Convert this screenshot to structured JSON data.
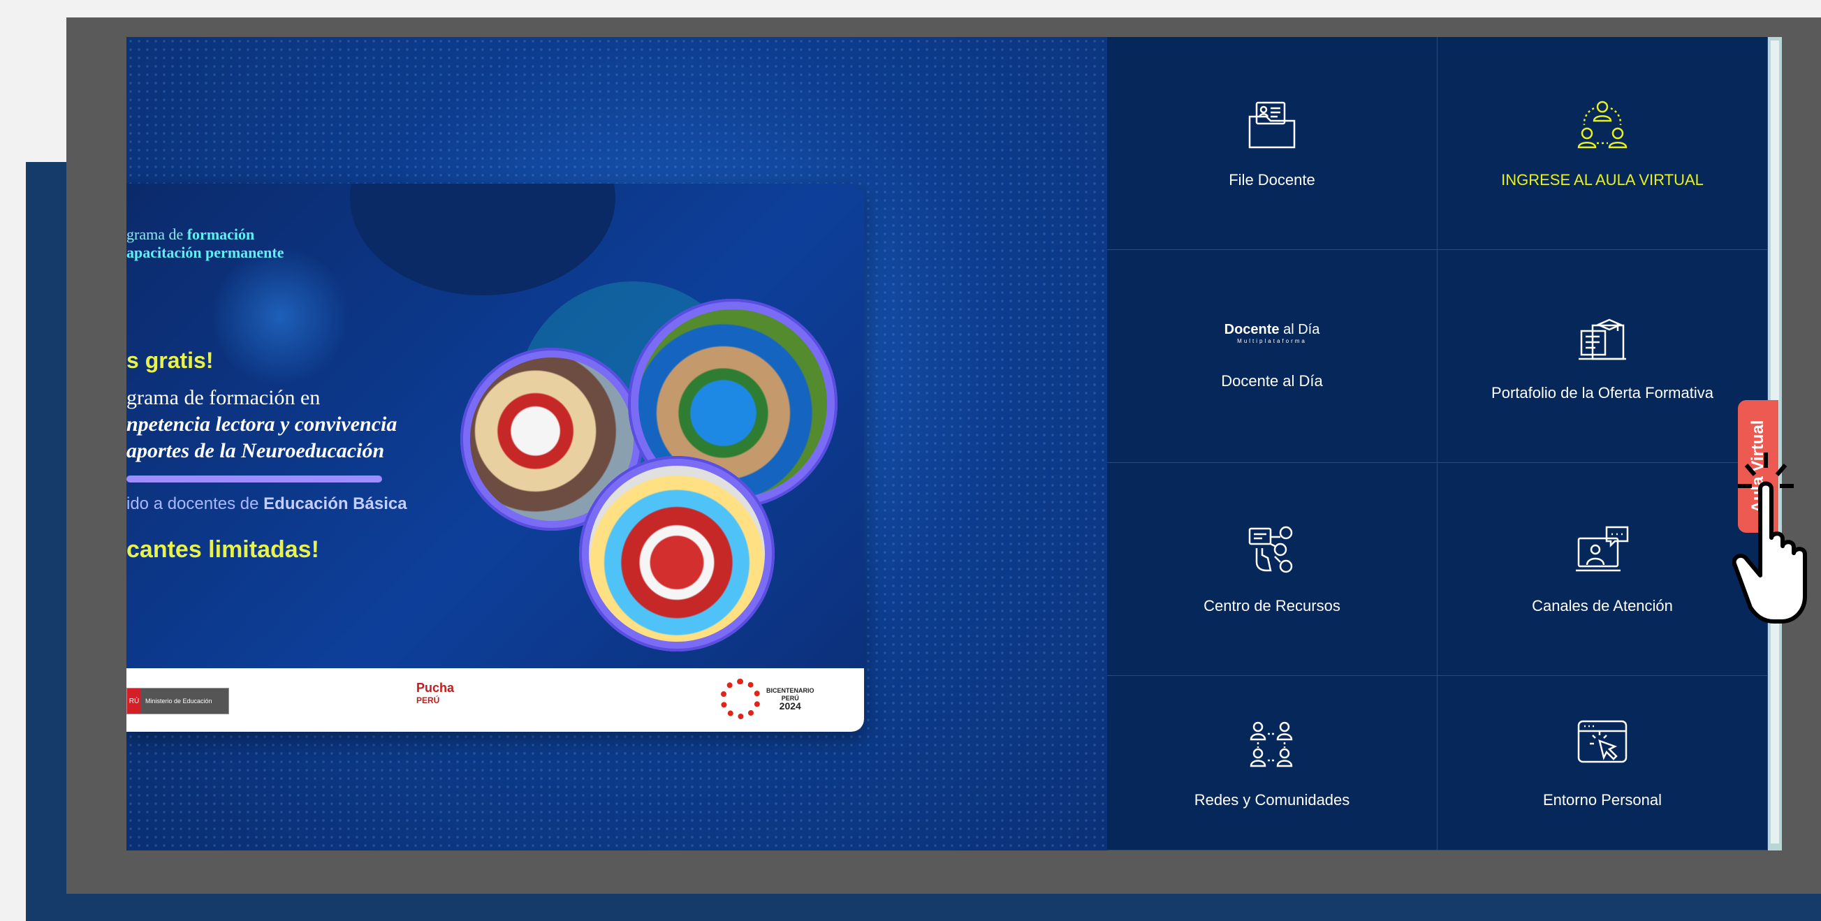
{
  "banner": {
    "program_prefix": "grama de ",
    "program_bold1": "formación",
    "program_line2": "apacitación permanente",
    "gratis": "s gratis!",
    "line1": "grama de formación en",
    "line2": "npetencia lectora y convivencia",
    "line3": "aportes de la Neuroeducación",
    "dirigido_prefix": "ido a docentes de ",
    "dirigido_bold": "Educación Básica",
    "vacantes": "cantes limitadas!",
    "footer": {
      "minedu_country": "RÚ",
      "minedu_label": "Ministerio de Educación",
      "pucha_line1": "Pucha",
      "pucha_line2": "PERÚ",
      "bicentenario_line1": "BICENTENARIO",
      "bicentenario_line2": "PERÚ",
      "bicentenario_year": "2024"
    }
  },
  "menu": {
    "items": [
      {
        "label": "File Docente",
        "icon": "file-docente-icon",
        "highlight": false
      },
      {
        "label": "INGRESE AL AULA VIRTUAL",
        "icon": "aula-virtual-icon",
        "highlight": true
      },
      {
        "label": "Docente al Día",
        "icon": "docente-al-dia-logo",
        "highlight": false
      },
      {
        "label": "Portafolio de la Oferta Formativa",
        "icon": "portafolio-icon",
        "highlight": false
      },
      {
        "label": "Centro de Recursos",
        "icon": "centro-recursos-icon",
        "highlight": false
      },
      {
        "label": "Canales de Atención",
        "icon": "canales-atencion-icon",
        "highlight": false
      },
      {
        "label": "Redes y Comunidades",
        "icon": "redes-icon",
        "highlight": false
      },
      {
        "label": "Entorno Personal",
        "icon": "entorno-personal-icon",
        "highlight": false
      }
    ],
    "docente_logo_bold": "Docente",
    "docente_logo_rest": " al Día",
    "docente_logo_sub": "Multiplataforma"
  },
  "aula_tab": "Aula Virtual",
  "colors": {
    "accent_yellow": "#e8f21a",
    "panel": "#06275a",
    "tab": "#ec5a52"
  }
}
